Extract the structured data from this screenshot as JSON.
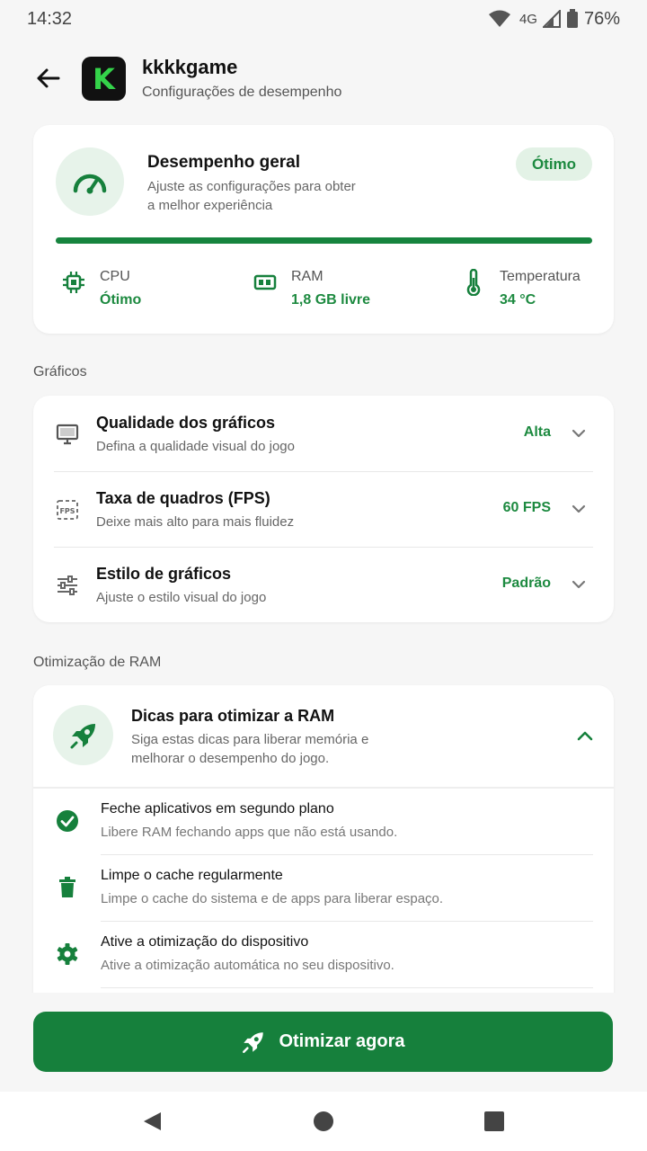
{
  "status_bar": {
    "time": "14:32",
    "network": "4G",
    "battery": "76%"
  },
  "header": {
    "app_name": "kkkkgame",
    "subtitle": "Configurações de desempenho",
    "logo_letter": "K"
  },
  "performance": {
    "title": "Desempenho geral",
    "description": "Ajuste as configurações para obter a melhor experiência",
    "badge": "Ótimo",
    "progress_percent": 100,
    "stats": [
      {
        "label": "CPU",
        "value": "Ótimo",
        "icon": "cpu-icon"
      },
      {
        "label": "RAM",
        "value": "1,8 GB livre",
        "icon": "ram-icon"
      },
      {
        "label": "Temperatura",
        "value": "34 °C",
        "icon": "thermometer-icon"
      }
    ]
  },
  "graphics": {
    "section_title": "Gráficos",
    "rows": [
      {
        "title": "Qualidade dos gráficos",
        "description": "Defina a qualidade visual do jogo",
        "value": "Alta",
        "icon": "monitor-icon"
      },
      {
        "title": "Taxa de quadros (FPS)",
        "description": "Deixe mais alto para mais fluidez",
        "value": "60 FPS",
        "icon": "fps-icon"
      },
      {
        "title": "Estilo de gráficos",
        "description": "Ajuste o estilo visual do jogo",
        "value": "Padrão",
        "icon": "sliders-icon"
      }
    ]
  },
  "ram": {
    "section_title": "Otimização de RAM",
    "title": "Dicas para otimizar a RAM",
    "description": "Siga estas dicas para liberar memória e melhorar o desempenho do jogo.",
    "tips": [
      {
        "title": "Feche aplicativos em segundo plano",
        "description": "Libere RAM fechando apps que não está usando.",
        "icon": "check-circle-icon"
      },
      {
        "title": "Limpe o cache regularmente",
        "description": "Limpe o cache do sistema e de apps para liberar espaço.",
        "icon": "trash-icon"
      },
      {
        "title": "Ative a otimização do dispositivo",
        "description": "Ative a otimização automática no seu dispositivo.",
        "icon": "gear-icon"
      }
    ]
  },
  "cta": {
    "label": "Otimizar agora"
  },
  "colors": {
    "accent": "#16803c",
    "accent_text": "#1d8a40",
    "accent_soft": "#e7f3ea"
  }
}
